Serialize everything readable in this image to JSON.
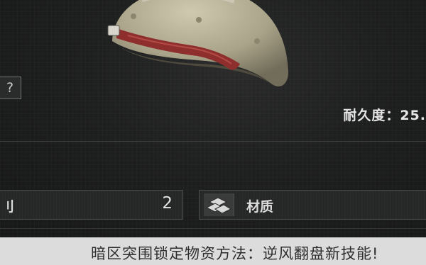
{
  "item_view": {
    "help_glyph": "?",
    "durability_text": "耐久度：25."
  },
  "stats": {
    "left_label": "刂",
    "left_value": "2",
    "right_label": "材质",
    "right_icon": "stacked-ingots-icon"
  },
  "caption": {
    "text": "暗区突围锁定物资方法：逆风翻盘新技能!"
  },
  "colors": {
    "helmet_body": "#b3ad94",
    "helmet_band": "#8e2f2d",
    "background": "#1b1c1c",
    "caption_bar": "#dcdcdc"
  }
}
